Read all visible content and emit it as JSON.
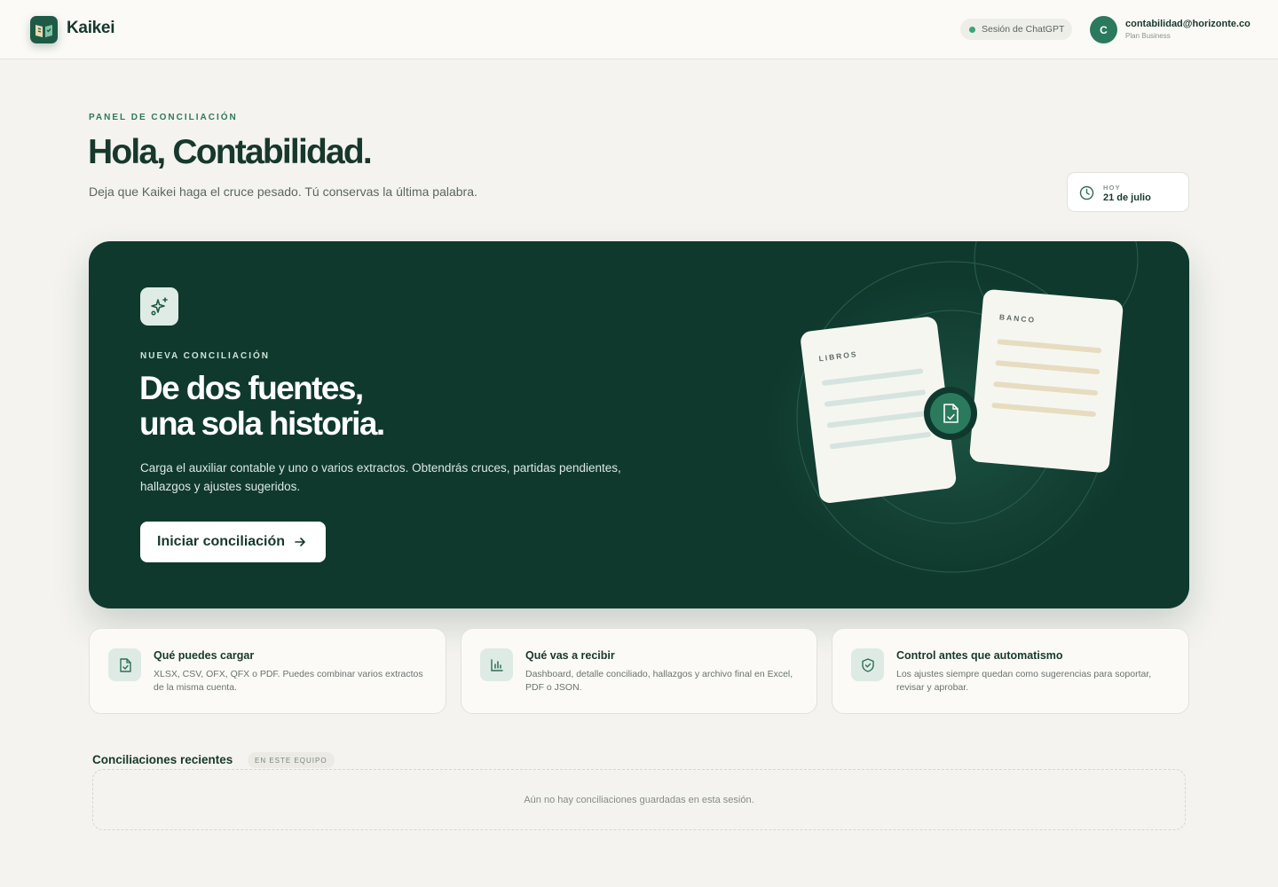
{
  "app": {
    "name": "Kaikei"
  },
  "header": {
    "session_label": "Sesión de ChatGPT",
    "user_initial": "C",
    "user_email": "contabilidad@horizonte.co",
    "user_plan": "Plan Business"
  },
  "greeting": {
    "eyebrow": "PANEL DE CONCILIACIÓN",
    "title": "Hola, Contabilidad.",
    "subtitle": "Deja que Kaikei haga el cruce pesado. Tú conservas la última palabra.",
    "date_label": "HOY",
    "date_value": "21 de julio"
  },
  "hero": {
    "eyebrow": "NUEVA CONCILIACIÓN",
    "title_line1": "De dos fuentes,",
    "title_line2": "una sola historia.",
    "description": "Carga el auxiliar contable y uno o varios extractos. Obtendrás cruces, partidas pendientes, hallazgos y ajustes sugeridos.",
    "button_label": "Iniciar conciliación",
    "doc_left_label": "LIBROS",
    "doc_right_label": "BANCO"
  },
  "cards": [
    {
      "icon": "file-check-icon",
      "title": "Qué puedes cargar",
      "text": "XLSX, CSV, OFX, QFX o PDF. Puedes combinar varios extractos de la misma cuenta."
    },
    {
      "icon": "bar-chart-icon",
      "title": "Qué vas a recibir",
      "text": "Dashboard, detalle conciliado, hallazgos y archivo final en Excel, PDF o JSON."
    },
    {
      "icon": "shield-check-icon",
      "title": "Control antes que automatismo",
      "text": "Los ajustes siempre quedan como sugerencias para soportar, revisar y aprobar."
    }
  ],
  "recent": {
    "title": "Conciliaciones recientes",
    "badge": "EN ESTE EQUIPO",
    "empty_text": "Aún no hay conciliaciones guardadas en esta sesión."
  },
  "colors": {
    "brand_dark": "#10392e",
    "accent": "#2d7a5b",
    "background": "#f4f3ef"
  }
}
